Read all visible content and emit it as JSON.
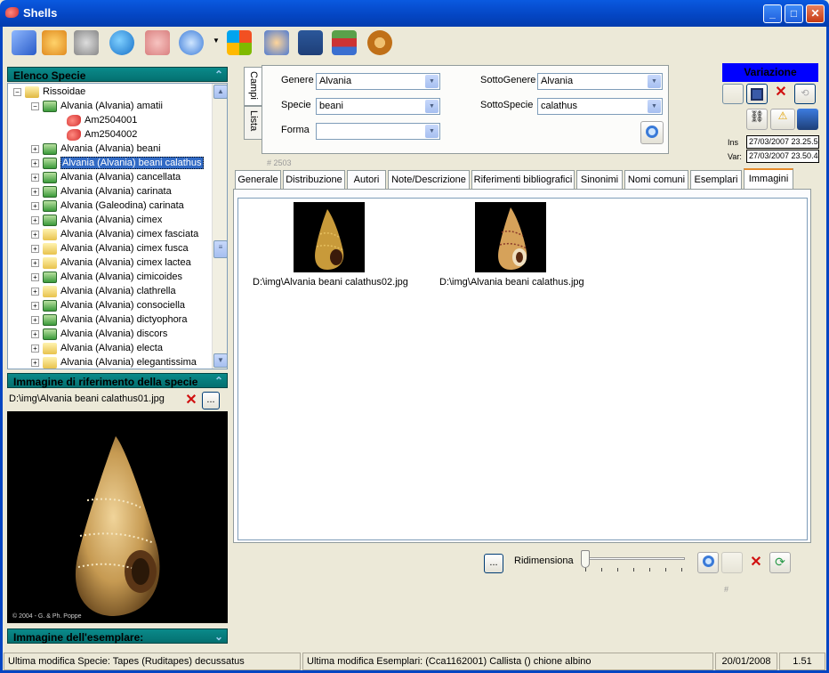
{
  "window": {
    "title": "Shells",
    "min": "_",
    "max": "□",
    "close": "✕"
  },
  "toolbar": {
    "icons": [
      "exit-door-icon",
      "help-icon",
      "author-icon",
      "globe-icon",
      "shell-map-icon",
      "search-tool-icon",
      "windows-icon",
      "users-icon",
      "export-word-icon",
      "books-icon",
      "settings-gear-icon"
    ]
  },
  "species_panel": {
    "title": "Elenco Specie",
    "tree": [
      {
        "label": "Rissoidae",
        "level": 0,
        "type": "family"
      },
      {
        "label": "Alvania (Alvania) amatii",
        "level": 1,
        "type": "species"
      },
      {
        "label": "Am2504001",
        "level": 2,
        "type": "specimen"
      },
      {
        "label": "Am2504002",
        "level": 2,
        "type": "specimen"
      },
      {
        "label": "Alvania (Alvania) beani",
        "level": 1,
        "type": "species"
      },
      {
        "label": "Alvania (Alvania) beani calathus",
        "level": 1,
        "type": "species",
        "selected": true
      },
      {
        "label": "Alvania (Alvania) cancellata",
        "level": 1,
        "type": "species"
      },
      {
        "label": "Alvania (Alvania) carinata",
        "level": 1,
        "type": "species"
      },
      {
        "label": "Alvania (Galeodina) carinata",
        "level": 1,
        "type": "species"
      },
      {
        "label": "Alvania (Alvania) cimex",
        "level": 1,
        "type": "species"
      },
      {
        "label": "Alvania (Alvania) cimex fasciata",
        "level": 1,
        "type": "folder"
      },
      {
        "label": "Alvania (Alvania) cimex fusca",
        "level": 1,
        "type": "folder"
      },
      {
        "label": "Alvania (Alvania) cimex lactea",
        "level": 1,
        "type": "folder"
      },
      {
        "label": "Alvania (Alvania) cimicoides",
        "level": 1,
        "type": "species"
      },
      {
        "label": "Alvania (Alvania) clathrella",
        "level": 1,
        "type": "folder"
      },
      {
        "label": "Alvania (Alvania) consociella",
        "level": 1,
        "type": "species"
      },
      {
        "label": "Alvania (Alvania) dictyophora",
        "level": 1,
        "type": "species"
      },
      {
        "label": "Alvania (Alvania) discors",
        "level": 1,
        "type": "species"
      },
      {
        "label": "Alvania (Alvania) electa",
        "level": 1,
        "type": "folder"
      },
      {
        "label": "Alvania (Alvania) elegantissima",
        "level": 1,
        "type": "folder"
      }
    ]
  },
  "ref_image_panel": {
    "title": "Immagine di riferimento della specie",
    "path": "D:\\img\\Alvania beani calathus01.jpg",
    "browse": "...",
    "credit": "© 2004 - G. & Ph. Poppe"
  },
  "specimen_panel": {
    "title": "Immagine dell'esemplare:"
  },
  "side_tabs": [
    "Campi",
    "Lista"
  ],
  "form": {
    "genere_label": "Genere",
    "genere": "Alvania",
    "specie_label": "Specie",
    "specie": "beani",
    "forma_label": "Forma",
    "forma": "",
    "sottogenere_label": "SottoGenere",
    "sottogenere": "Alvania",
    "sottospecie_label": "SottoSpecie",
    "sottospecie": "calathus",
    "record_id": "# 2503"
  },
  "variation": {
    "title": "Variazione",
    "ins_label": "Ins",
    "ins": "27/03/2007 23.25.5",
    "var_label": "Var:",
    "var": "27/03/2007 23.50.4"
  },
  "tabs": [
    "Generale",
    "Distribuzione",
    "Autori",
    "Note/Descrizione",
    "Riferimenti bibliografici",
    "Sinonimi",
    "Nomi comuni",
    "Esemplari",
    "Immagini"
  ],
  "active_tab": "Immagini",
  "images": [
    {
      "caption": "D:\\img\\Alvania beani calathus02.jpg"
    },
    {
      "caption": "D:\\img\\Alvania beani calathus.jpg"
    }
  ],
  "image_controls": {
    "browse": "...",
    "resize_label": "Ridimensiona",
    "hash": "#"
  },
  "status": {
    "species": "Ultima modifica Specie: Tapes  (Ruditapes) decussatus",
    "specimens": "Ultima modifica Esemplari: (Cca1162001) Callista  () chione  albino",
    "date": "20/01/2008",
    "version": "1.51"
  },
  "colors": {
    "titlebar": "#0445c2",
    "panel_header": "#047070",
    "variazione": "#0000ff"
  }
}
